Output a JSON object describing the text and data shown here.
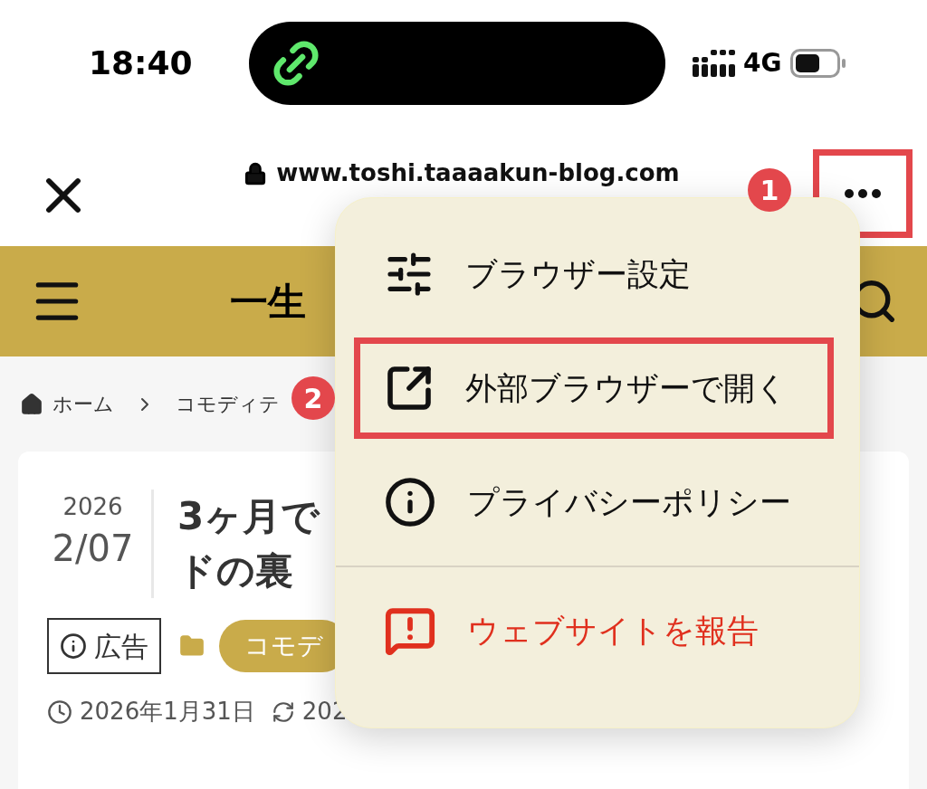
{
  "status_bar": {
    "time": "18:40",
    "network": "4G"
  },
  "browser_bar": {
    "url": "www.toshi.taaaakun-blog.com",
    "more_button": {
      "annotation": "1"
    }
  },
  "site_header": {
    "title": "一生"
  },
  "breadcrumb": [
    {
      "label": "ホーム"
    },
    {
      "label": "コモディテ"
    }
  ],
  "article": {
    "year": "2026",
    "date": "2/07",
    "title_lines": [
      "3ヶ月で",
      "ドの裏"
    ],
    "ad_label": "広告",
    "category": "コモデ",
    "published": "2026年1月31日",
    "updated": "202"
  },
  "menu": {
    "items": [
      {
        "kind": "settings",
        "label": "ブラウザー設定"
      },
      {
        "kind": "external",
        "label": "外部ブラウザーで開く",
        "annotation": "2"
      },
      {
        "kind": "info",
        "label": "プライバシーポリシー"
      },
      {
        "kind": "report",
        "label": "ウェブサイトを報告"
      }
    ]
  }
}
